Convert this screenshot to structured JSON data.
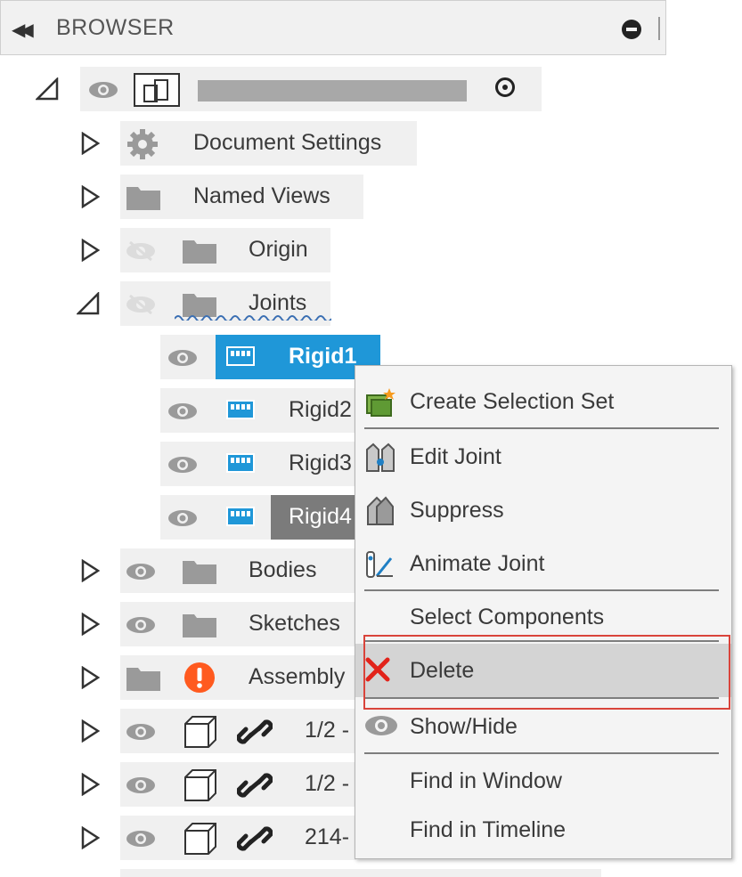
{
  "header": {
    "title": "BROWSER"
  },
  "tree": {
    "root_name_redacted": "",
    "document_settings": "Document Settings",
    "named_views": "Named Views",
    "origin": "Origin",
    "joints": "Joints",
    "joint_items": [
      "Rigid1",
      "Rigid2",
      "Rigid3",
      "Rigid4"
    ],
    "bodies": "Bodies",
    "sketches": "Sketches",
    "assembly": "Assembly",
    "comp_rows": [
      "1/2 -",
      "1/2 -",
      "214-"
    ]
  },
  "context_menu": {
    "items": [
      "Create Selection Set",
      "Edit Joint",
      "Suppress",
      "Animate Joint",
      "Select Components",
      "Delete",
      "Show/Hide",
      "Find in Window",
      "Find in Timeline"
    ]
  },
  "colors": {
    "selection": "#1f97d8",
    "hover": "#7b7b7b",
    "delete_x": "#e2231a",
    "warning": "#ff5a1f",
    "highlight_box": "#d9443b"
  }
}
